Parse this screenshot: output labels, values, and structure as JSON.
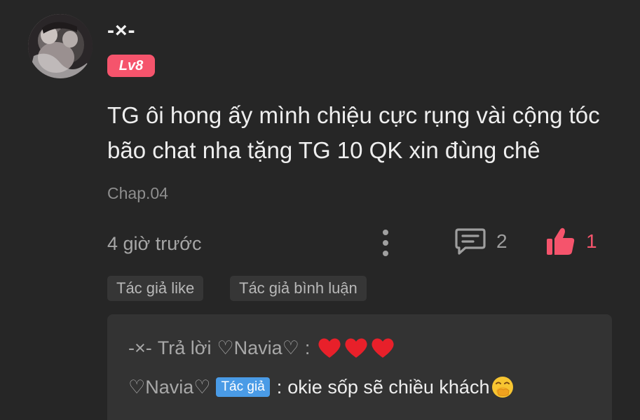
{
  "comment": {
    "username": "-×-",
    "level": "Lv8",
    "text": "TG ôi hong ấy mình chiệu cực rụng vài cộng tóc bão chat nha tặng TG 10 QK xin đùng chê",
    "chapter": "Chap.04",
    "time": "4 giờ trước",
    "reply_count": "2",
    "like_count": "1"
  },
  "tags": {
    "author_like": "Tác giả like",
    "author_reply": "Tác giả bình luận"
  },
  "replies": {
    "first": {
      "author": "-×-",
      "action": "Trả lời",
      "target": "♡Navia♡",
      "separator": ":"
    },
    "second": {
      "author": "♡Navia♡",
      "badge": "Tác giả",
      "separator": ":",
      "text": "okie sốp sẽ chiều khách"
    }
  },
  "icons": {
    "more": "more-vertical-icon",
    "reply": "comment-icon",
    "like": "thumbs-up-icon",
    "heart": "heart-icon",
    "emoji": "giggle-emoji-icon"
  },
  "colors": {
    "background": "#262626",
    "accent": "#f5546c",
    "author_badge": "#4a9be6",
    "heart": "#e8202a"
  }
}
